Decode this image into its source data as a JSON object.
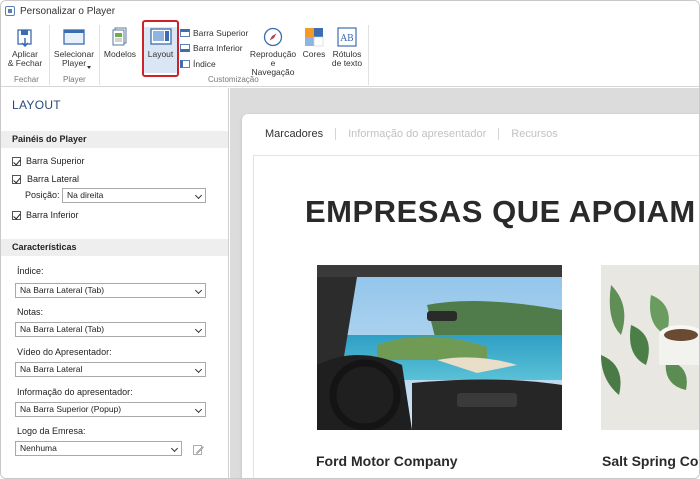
{
  "window": {
    "title": "Personalizar o Player"
  },
  "ribbon": {
    "apply_close": "Aplicar\n& Fechar",
    "select_player": "Selecionar\nPlayer",
    "models": "Modelos",
    "layout": "Layout",
    "top_bar": "Barra Superior",
    "bottom_bar": "Barra Inferior",
    "index": "Índice",
    "playback_nav": "Reprodução\ne Navegação",
    "colors": "Cores",
    "text_labels": "Rótulos\nde texto",
    "groups": {
      "close": "Fechar",
      "player": "Player",
      "customization": "Customização"
    }
  },
  "panel": {
    "title": "LAYOUT",
    "player_panels": {
      "header": "Painéis do Player",
      "top_bar": "Barra Superior",
      "side_bar": "Barra Lateral",
      "position_label": "Posição:",
      "position_value": "Na direita",
      "bottom_bar": "Barra Inferior"
    },
    "features": {
      "header": "Características",
      "index_label": "Índice:",
      "index_value": "Na Barra Lateral (Tab)",
      "notes_label": "Notas:",
      "notes_value": "Na Barra Lateral (Tab)",
      "presenter_video_label": "Vídeo do Apresentador:",
      "presenter_video_value": "Na Barra Lateral",
      "presenter_info_label": "Informação do apresentador:",
      "presenter_info_value": "Na Barra Superior (Popup)",
      "logo_label": "Logo da Emresa:",
      "logo_value": "Nenhuma"
    }
  },
  "preview": {
    "tabs": [
      "Marcadores",
      "Informação do apresentador",
      "Recursos"
    ],
    "heading": "EMPRESAS QUE APOIAM",
    "companies": [
      "Ford Motor Company",
      "Salt Spring Co"
    ]
  }
}
